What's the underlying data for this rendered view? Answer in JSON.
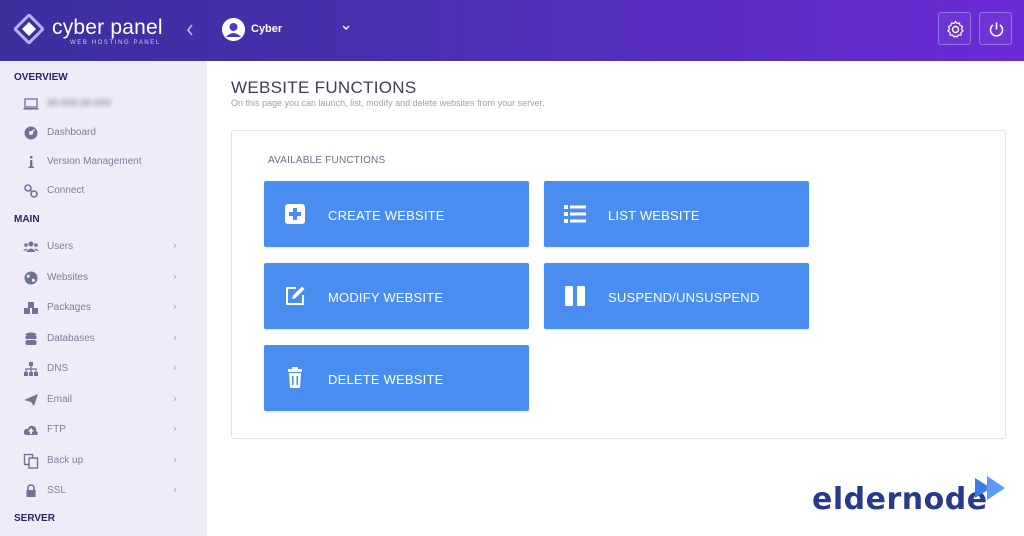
{
  "header": {
    "logo_text": "cyber panel",
    "logo_subtext": "WEB HOSTING PANEL",
    "collapse_icon": "chevron-left-icon",
    "user": {
      "name": "Cyber",
      "avatar_icon": "user-avatar-icon"
    },
    "actions": [
      {
        "name": "settings",
        "icon": "gear-icon"
      },
      {
        "name": "logout",
        "icon": "power-icon"
      }
    ],
    "gradient": [
      "#3b2f9e",
      "#6a2ad6"
    ]
  },
  "sidebar": {
    "sections": {
      "overview": "OVERVIEW",
      "main": "MAIN",
      "server": "SERVER"
    },
    "overview_items": [
      {
        "label": "00.000.00.000",
        "icon": "monitor-icon"
      },
      {
        "label": "Dashboard",
        "icon": "dashboard-icon"
      },
      {
        "label": "Version Management",
        "icon": "info-icon"
      },
      {
        "label": "Connect",
        "icon": "link-icon"
      }
    ],
    "main_items": [
      {
        "label": "Users",
        "icon": "users-icon"
      },
      {
        "label": "Websites",
        "icon": "globe-icon"
      },
      {
        "label": "Packages",
        "icon": "packages-icon"
      },
      {
        "label": "Databases",
        "icon": "database-icon"
      },
      {
        "label": "DNS",
        "icon": "sitemap-icon"
      },
      {
        "label": "Email",
        "icon": "paper-plane-icon"
      },
      {
        "label": "FTP",
        "icon": "cloud-upload-icon"
      },
      {
        "label": "Back up",
        "icon": "backup-icon"
      },
      {
        "label": "SSL",
        "icon": "lock-icon"
      }
    ],
    "chevron": "›"
  },
  "main": {
    "title": "WEBSITE FUNCTIONS",
    "subtitle": "On this page you can launch, list, modify and delete websites from your server.",
    "panel_label": "AVAILABLE FUNCTIONS",
    "functions": [
      {
        "label": "CREATE WEBSITE",
        "icon": "plus-square-icon"
      },
      {
        "label": "LIST WEBSITE",
        "icon": "list-icon"
      },
      {
        "label": "MODIFY WEBSITE",
        "icon": "edit-icon"
      },
      {
        "label": "SUSPEND/UNSUSPEND",
        "icon": "pause-icon"
      },
      {
        "label": "DELETE WEBSITE",
        "icon": "trash-icon"
      }
    ],
    "button_color": "#4a8df0"
  },
  "watermark": {
    "text": "eldernode"
  }
}
